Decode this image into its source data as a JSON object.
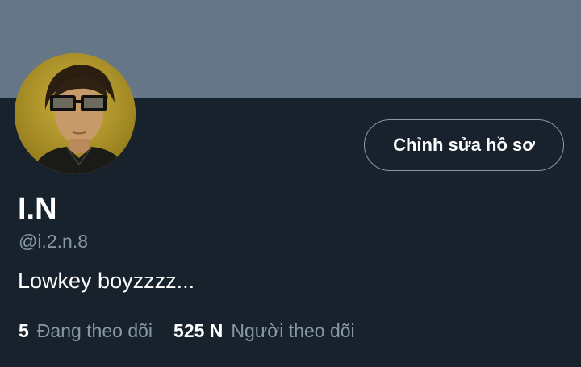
{
  "profile": {
    "display_name": "I.N",
    "handle": "@i.2.n.8",
    "bio": "Lowkey boyzzzz...",
    "edit_button_label": "Chỉnh sửa hồ sơ"
  },
  "stats": {
    "following_count": "5",
    "following_label": "Đang theo dõi",
    "followers_count": "525 N",
    "followers_label": "Người theo dõi"
  },
  "colors": {
    "background": "#18222d",
    "banner": "#657786",
    "text_primary": "#ffffff",
    "text_secondary": "#8899a6",
    "button_border": "#8899a6"
  },
  "icons": {
    "avatar": "profile-photo"
  }
}
